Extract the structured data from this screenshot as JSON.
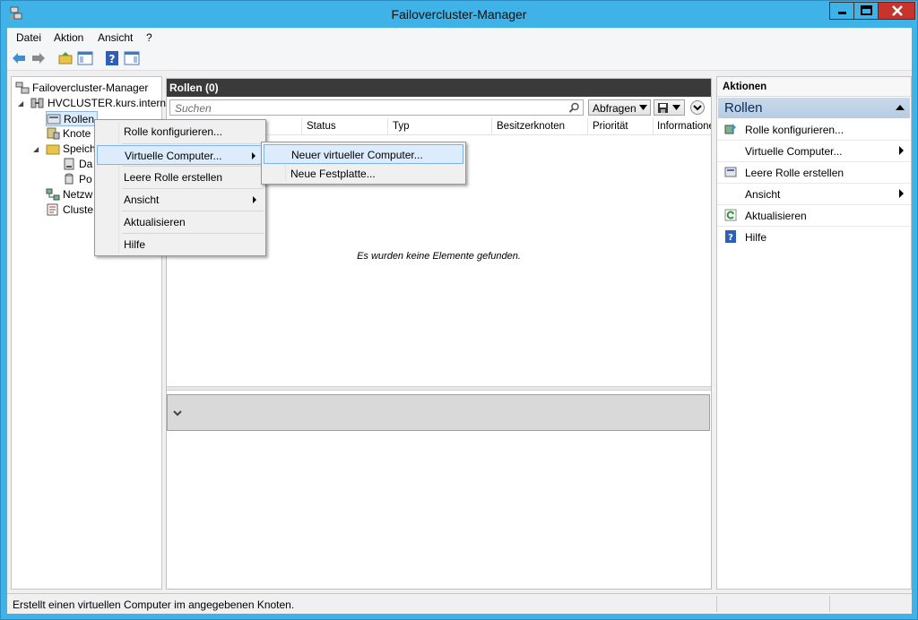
{
  "window": {
    "title": "Failovercluster-Manager"
  },
  "menubar": {
    "items": [
      "Datei",
      "Aktion",
      "Ansicht",
      "?"
    ]
  },
  "tree": {
    "root": "Failovercluster-Manager",
    "cluster": "HVCLUSTER.kurs.intern",
    "items": [
      "Rollen",
      "Knote",
      "Speich",
      "Da",
      "Po",
      "Netzw",
      "Cluste"
    ]
  },
  "center": {
    "header": "Rollen (0)",
    "search_placeholder": "Suchen",
    "query_button": "Abfragen",
    "columns": [
      "Status",
      "Typ",
      "Besitzerknoten",
      "Priorität",
      "Informationen"
    ],
    "empty_message": "Es wurden keine Elemente gefunden."
  },
  "actions": {
    "header": "Aktionen",
    "section": "Rollen",
    "items": [
      "Rolle konfigurieren...",
      "Virtuelle Computer...",
      "Leere Rolle erstellen",
      "Ansicht",
      "Aktualisieren",
      "Hilfe"
    ]
  },
  "context_menu": {
    "items": [
      "Rolle konfigurieren...",
      "Virtuelle Computer...",
      "Leere Rolle erstellen",
      "Ansicht",
      "Aktualisieren",
      "Hilfe"
    ]
  },
  "submenu": {
    "items": [
      "Neuer virtueller Computer...",
      "Neue Festplatte..."
    ]
  },
  "statusbar": {
    "text": "Erstellt einen virtuellen Computer im angegebenen Knoten."
  },
  "colors": {
    "titlebar": "#3fb2e8",
    "close": "#c7342b",
    "header_dark": "#3a3a3a",
    "highlight": "#dcecfc"
  }
}
